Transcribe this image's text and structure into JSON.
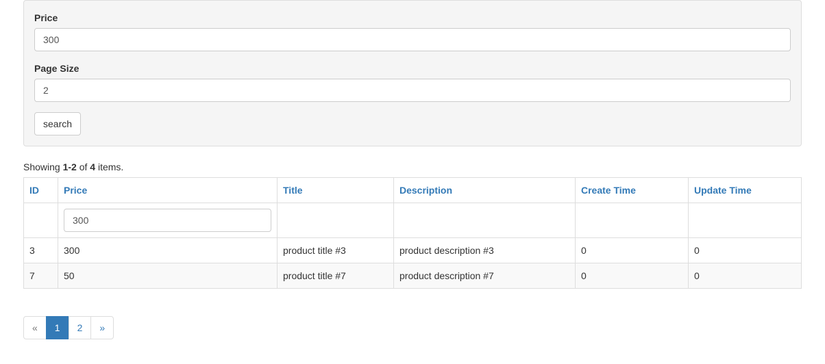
{
  "form": {
    "price_label": "Price",
    "price_value": "300",
    "pagesize_label": "Page Size",
    "pagesize_value": "2",
    "search_button": "search"
  },
  "summary": {
    "prefix": "Showing ",
    "range": "1-2",
    "mid": " of ",
    "total": "4",
    "suffix": " items."
  },
  "table": {
    "headers": {
      "id": "ID",
      "price": "Price",
      "title": "Title",
      "description": "Description",
      "create_time": "Create Time",
      "update_time": "Update Time"
    },
    "filter": {
      "price": "300"
    },
    "rows": [
      {
        "id": "3",
        "price": "300",
        "title": "product title #3",
        "description": "product description #3",
        "create_time": "0",
        "update_time": "0"
      },
      {
        "id": "7",
        "price": "50",
        "title": "product title #7",
        "description": "product description #7",
        "create_time": "0",
        "update_time": "0"
      }
    ]
  },
  "pagination": {
    "prev": "«",
    "pages": [
      "1",
      "2"
    ],
    "active_index": 0,
    "next": "»"
  }
}
